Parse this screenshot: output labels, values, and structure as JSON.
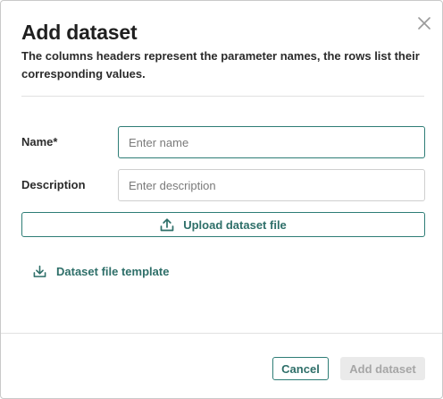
{
  "dialog": {
    "title": "Add dataset",
    "subtitle": "The columns headers represent the parameter names, the rows list their corresponding values."
  },
  "form": {
    "name": {
      "label": "Name*",
      "placeholder": "Enter name",
      "value": ""
    },
    "description": {
      "label": "Description",
      "placeholder": "Enter description",
      "value": ""
    }
  },
  "actions": {
    "upload_label": "Upload dataset file",
    "template_label": "Dataset file template",
    "cancel_label": "Cancel",
    "add_label": "Add dataset"
  },
  "icons": {
    "close": "close-icon",
    "upload": "upload-icon",
    "download": "download-icon"
  },
  "colors": {
    "accent": "#2e7d76",
    "accent_text": "#2e6f69",
    "disabled_bg": "#eaeaea",
    "disabled_text": "#a6a6a6"
  }
}
